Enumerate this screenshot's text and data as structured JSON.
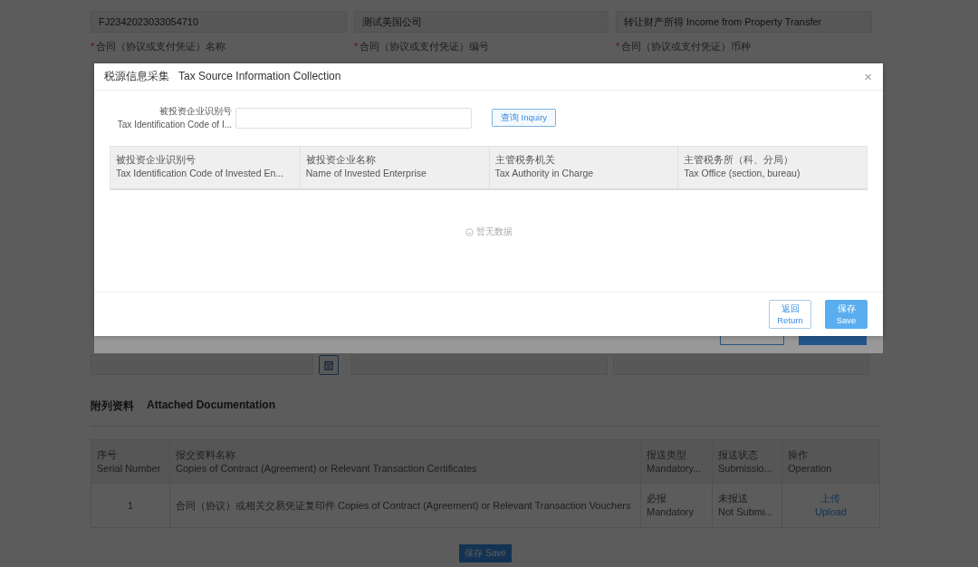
{
  "page": {
    "fields": [
      {
        "value": "FJ2342023033054710"
      },
      {
        "value": "测试美国公司"
      },
      {
        "value": "转让财产所得 Income from Property Transfer"
      }
    ],
    "field_labels": [
      {
        "required_mark": "*",
        "zh": "合同（协议或支付凭证）名称"
      },
      {
        "required_mark": "*",
        "zh": "合同（协议或支付凭证）编号"
      },
      {
        "required_mark": "*",
        "zh": "合同（协议或支付凭证）币种"
      }
    ],
    "attached": {
      "title_zh": "附列资料",
      "title_en": "Attached Documentation",
      "columns": [
        {
          "zh": "序号",
          "en": "Serial Number"
        },
        {
          "zh": "报交资料名称",
          "en": "Copies of Contract (Agreement) or Relevant Transaction Certificates"
        },
        {
          "zh": "报送类型",
          "en": "Mandatory..."
        },
        {
          "zh": "报送状态",
          "en": "Submissio..."
        },
        {
          "zh": "操作",
          "en": "Operation"
        }
      ],
      "rows": [
        {
          "serial": "1",
          "name": "合同（协议）或相关交易凭证复印件 Copies of Contract (Agreement) or Relevant Transaction Vouchers",
          "type_zh": "必报",
          "type_en": "Mandatory",
          "status_zh": "未报送",
          "status_en": "Not Submi...",
          "action_zh": "上传",
          "action_en": "Upload"
        }
      ]
    },
    "save_button": "保存 Save"
  },
  "parent_dialog": {
    "buttons": [
      {
        "kind": "secondary"
      },
      {
        "kind": "primary"
      }
    ]
  },
  "modal": {
    "title_zh": "税源信息采集",
    "title_en": "Tax Source Information Collection",
    "close": "×",
    "search": {
      "label_zh": "被投资企业识别号",
      "label_en": "Tax Identification Code of I...",
      "button": "查询 Inquiry"
    },
    "columns": [
      {
        "zh": "被投资企业识别号",
        "en": "Tax Identification Code of Invested En..."
      },
      {
        "zh": "被投资企业名称",
        "en": "Name of Invested Enterprise"
      },
      {
        "zh": "主管税务机关",
        "en": "Tax Authority in Charge"
      },
      {
        "zh": "主管税务所（科、分局）",
        "en": "Tax Office (section, bureau)"
      }
    ],
    "empty_text": "暂无数据",
    "buttons": [
      {
        "kind": "secondary",
        "zh": "返回",
        "en": "Return"
      },
      {
        "kind": "primary",
        "zh": "保存",
        "en": "Save"
      }
    ]
  }
}
